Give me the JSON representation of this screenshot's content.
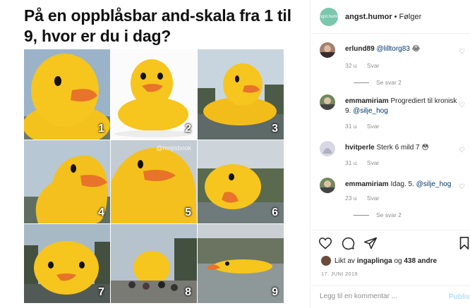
{
  "post": {
    "title": "På en oppblåsbar and-skala fra 1 til 9, hvor er du i dag?",
    "watermark": "@mojisbook",
    "tiles": [
      {
        "number": "1"
      },
      {
        "number": "2"
      },
      {
        "number": "3"
      },
      {
        "number": "4"
      },
      {
        "number": "5"
      },
      {
        "number": "6"
      },
      {
        "number": "7"
      },
      {
        "number": "8"
      },
      {
        "number": "9"
      }
    ]
  },
  "header": {
    "username": "angst.humor",
    "separator": "•",
    "follow_label": "Følger",
    "avatar_text": "angst.humor"
  },
  "comments": [
    {
      "user": "erlund89",
      "text": "",
      "mention": "@lilltorg83",
      "emoji": "😂",
      "time": "32 u",
      "reply": "Svar",
      "replies": "Se svar 2"
    },
    {
      "user": "emmamiriam",
      "text": "Progrediert til kronisk 9.",
      "mention": "@silje_hog",
      "emoji": "",
      "time": "31 u",
      "reply": "Svar",
      "replies": ""
    },
    {
      "user": "hvitperle",
      "text": "Sterk 6 mild 7",
      "mention": "",
      "emoji": "😳",
      "time": "31 u",
      "reply": "Svar",
      "replies": ""
    },
    {
      "user": "emmamiriam",
      "text": "Idag. 5.",
      "mention": "@silje_hog",
      "emoji": "",
      "time": "23 u",
      "reply": "Svar",
      "replies": "Se svar 2"
    }
  ],
  "likes": {
    "prefix": "Likt av",
    "user": "ingaplinga",
    "suffix": "og",
    "others": "438 andre"
  },
  "date": "17. JUNI 2019",
  "add_comment": {
    "placeholder": "Legg til en kommentar ...",
    "publish_label": "Publis"
  },
  "icons": {
    "like": "heart-icon",
    "comment": "comment-icon",
    "share": "share-icon",
    "save": "bookmark-icon"
  },
  "colors": {
    "duck_yellow": "#f6c51e",
    "beak_orange": "#e8732a",
    "mention_blue": "#00376b",
    "meta_gray": "#8e8e8e",
    "publish_blue": "#b2dffc"
  }
}
